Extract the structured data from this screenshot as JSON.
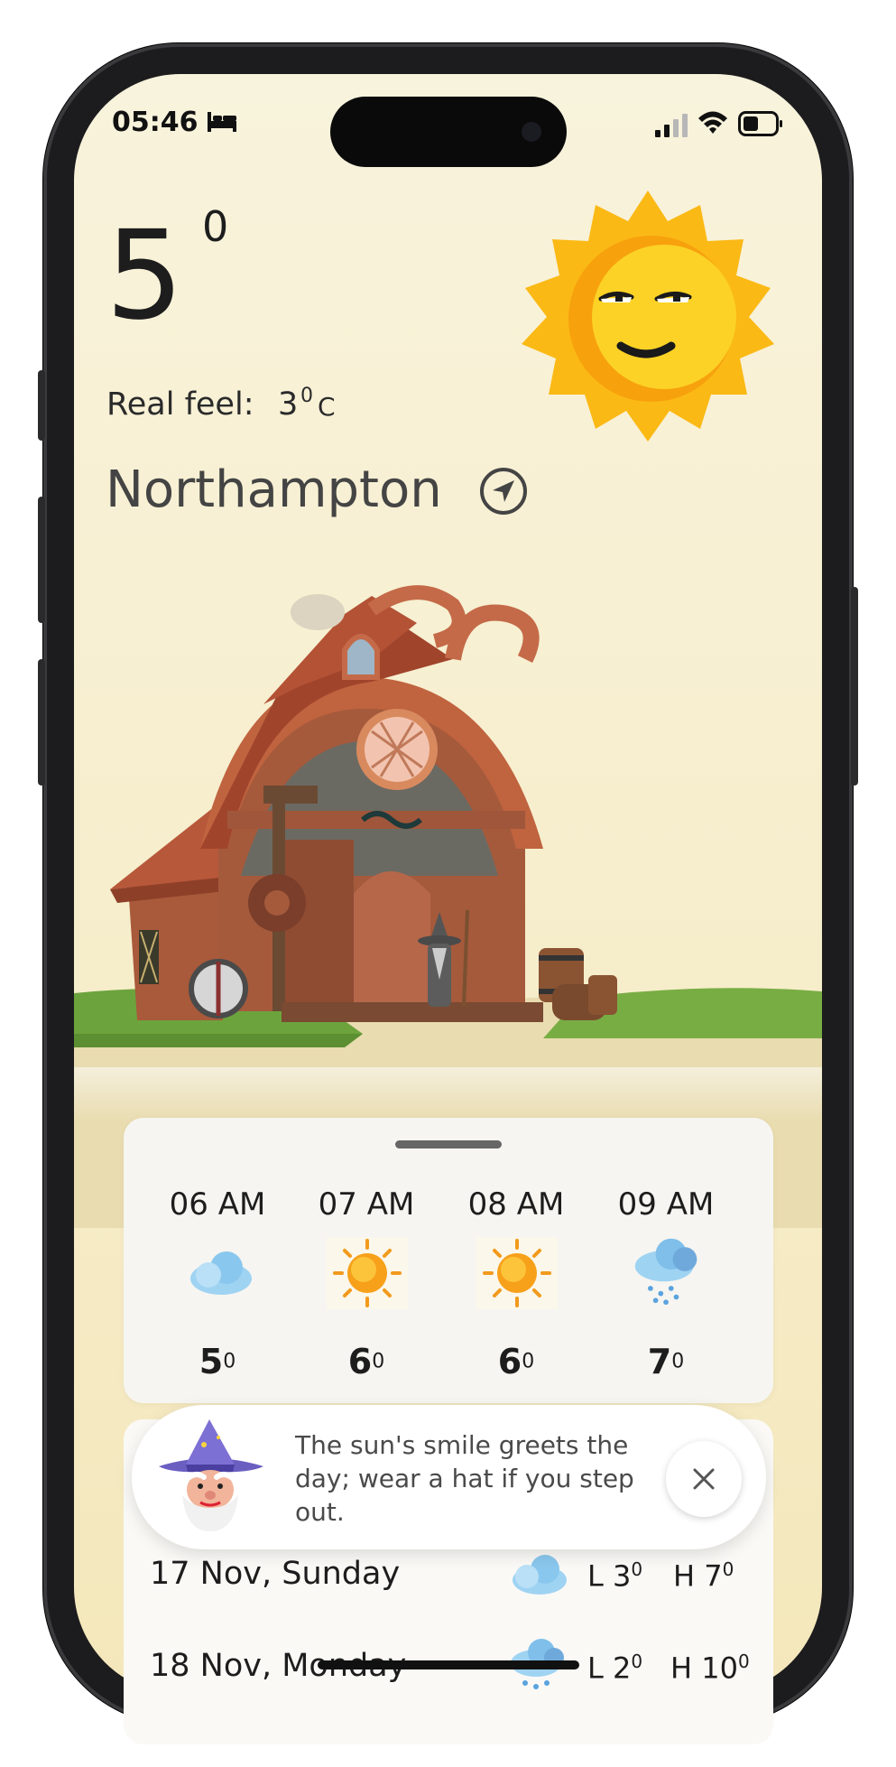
{
  "status_bar": {
    "time": "05:46",
    "sleep_icon": "bed-icon",
    "signal_icon": "cellular-signal-icon",
    "wifi_icon": "wifi-icon",
    "battery_icon": "battery-icon"
  },
  "current": {
    "temp": "5",
    "temp_unit": "0",
    "real_feel_label": "Real feel:",
    "real_feel_value": "3",
    "real_feel_deg": "0",
    "real_feel_unit": "C",
    "city": "Northampton",
    "weather_icon": "smiling-sun-icon",
    "location_icon": "location-arrow-icon"
  },
  "hourly": [
    {
      "time": "06 AM",
      "icon": "cloud-icon",
      "temp": "5",
      "deg": "0"
    },
    {
      "time": "07 AM",
      "icon": "sun-icon",
      "temp": "6",
      "deg": "0"
    },
    {
      "time": "08 AM",
      "icon": "sun-icon",
      "temp": "6",
      "deg": "0"
    },
    {
      "time": "09 AM",
      "icon": "rain-cloud-icon",
      "temp": "7",
      "deg": "0"
    }
  ],
  "tip": {
    "text": "The sun's smile greets the day; wear a hat if you step out.",
    "avatar": "wizard-avatar",
    "close_icon": "close-icon"
  },
  "daily": [
    {
      "date": "17 Nov, Sunday",
      "icon": "cloud-icon",
      "low_label": "L",
      "low": "3",
      "low_deg": "0",
      "high_label": "H",
      "high": "7",
      "high_deg": "0"
    },
    {
      "date": "18 Nov, Monday",
      "icon": "rain-cloud-icon",
      "low_label": "L",
      "low": "2",
      "low_deg": "0",
      "high_label": "H",
      "high": "10",
      "high_deg": "0"
    }
  ],
  "colors": {
    "background_top": "#f8f3dc",
    "background_bottom": "#f4e7bb",
    "sun": "#fbb915",
    "text": "#1d1d1d"
  }
}
